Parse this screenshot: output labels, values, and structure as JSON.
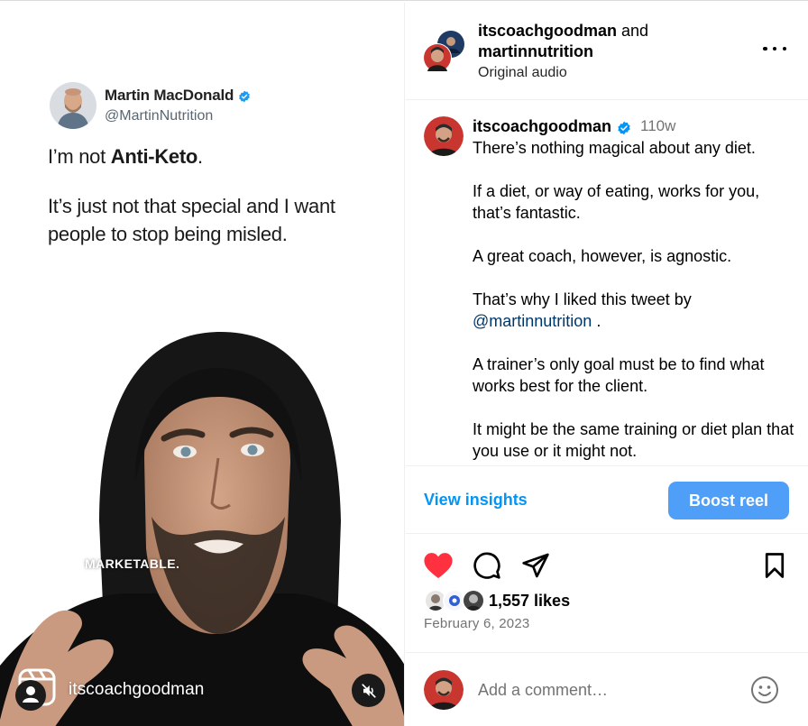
{
  "media": {
    "tweet": {
      "name": "Martin MacDonald",
      "handle": "@MartinNutrition",
      "line1_pre": "I’m not ",
      "line1_bold": "Anti-Keto",
      "line1_post": ".",
      "line2": "It’s just not that special and I want people to stop being misled."
    },
    "overlay_text": "MARKETABLE.",
    "reel_username": "itscoachgoodman",
    "icons": {
      "reel": "reels-icon",
      "mute": "muted-speaker-icon"
    }
  },
  "header": {
    "user1": "itscoachgoodman",
    "and_text": " and",
    "user2": "martinnutrition",
    "audio": "Original audio",
    "more_icon": "more-options-icon"
  },
  "caption": {
    "username": "itscoachgoodman",
    "time": "110w",
    "paragraphs": [
      "There’s nothing magical about any diet.",
      "If a diet, or way of eating, works for you, that’s fantastic.",
      "A great coach, however, is agnostic.",
      "That’s why I liked this tweet by",
      "A trainer’s only goal must be to find what works best for the client.",
      "It might be the same training or diet plan that you use or it might not."
    ],
    "mention": "@martinnutrition",
    "mention_suffix": " ."
  },
  "insights": {
    "view_label": "View insights",
    "boost_label": "Boost reel"
  },
  "actions": {
    "like_icon": "heart-filled-icon",
    "comment_icon": "comment-icon",
    "share_icon": "share-icon",
    "save_icon": "bookmark-icon",
    "like_color": "#ff3040"
  },
  "likes": {
    "count_text": "1,557 likes",
    "date": "February 6, 2023"
  },
  "comment": {
    "placeholder": "Add a comment…",
    "emoji_icon": "emoji-icon"
  },
  "colors": {
    "link_blue": "#0095f6",
    "boost_bg": "#4f9ef8",
    "verified": "#0095f6",
    "mention": "#00376b"
  }
}
